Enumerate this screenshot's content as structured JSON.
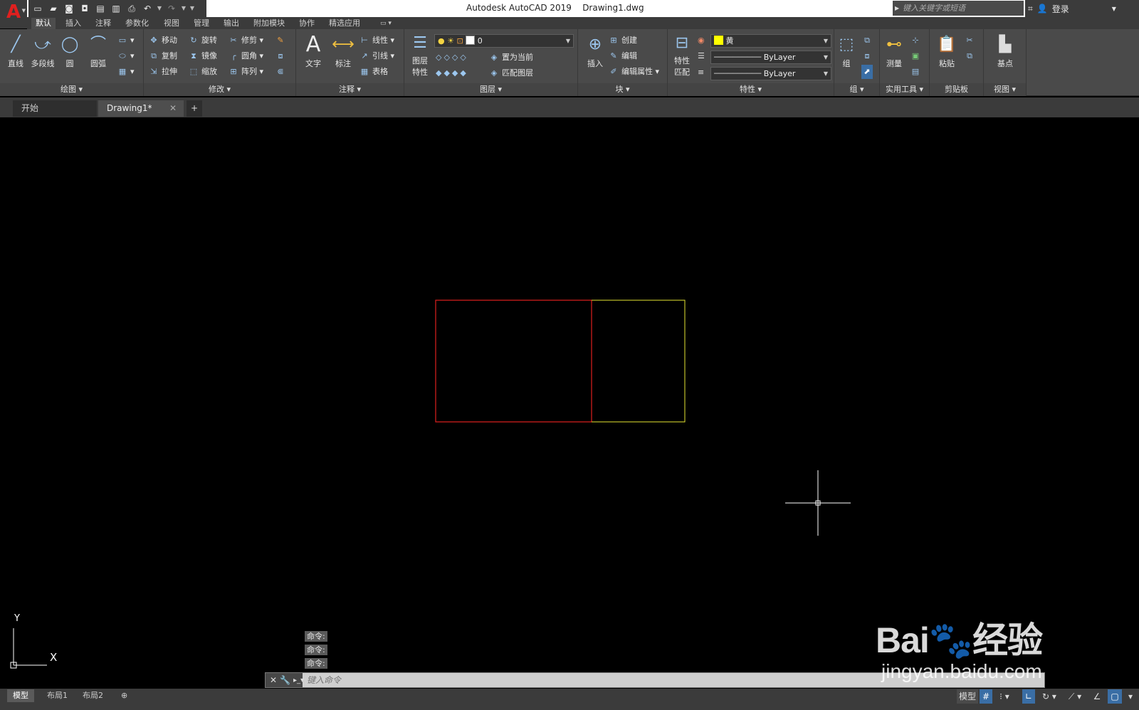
{
  "app": {
    "logo": "A",
    "title": "Autodesk AutoCAD 2019",
    "filename": "Drawing1.dwg"
  },
  "search": {
    "placeholder": "键入关键字或短语"
  },
  "user": {
    "login": "登录"
  },
  "ribbon_tabs": [
    "默认",
    "插入",
    "注释",
    "参数化",
    "视图",
    "管理",
    "输出",
    "附加模块",
    "协作",
    "精选应用"
  ],
  "panels": {
    "draw": {
      "title": "绘图",
      "line": "直线",
      "polyline": "多段线",
      "circle": "圆",
      "arc": "圆弧"
    },
    "modify": {
      "title": "修改",
      "move": "移动",
      "rotate": "旋转",
      "trim": "修剪",
      "copy": "复制",
      "mirror": "镜像",
      "fillet": "圆角",
      "stretch": "拉伸",
      "scale": "缩放",
      "array": "阵列"
    },
    "annotation": {
      "title": "注释",
      "text": "文字",
      "dimension": "标注",
      "linear": "线性",
      "leader": "引线",
      "table": "表格"
    },
    "layers": {
      "title": "图层",
      "properties_line1": "图层",
      "properties_line2": "特性",
      "current_layer": "0",
      "make_current": "置为当前",
      "match_layer": "匹配图层"
    },
    "block": {
      "title": "块",
      "insert": "插入",
      "create": "创建",
      "edit": "编辑",
      "edit_attributes": "编辑属性"
    },
    "properties": {
      "title": "特性",
      "match_line1": "特性",
      "match_line2": "匹配",
      "color": "黄",
      "linetype": "ByLayer",
      "lineweight": "ByLayer"
    },
    "groups": {
      "title": "组",
      "group": "组"
    },
    "utilities": {
      "title": "实用工具",
      "measure": "测量"
    },
    "clipboard": {
      "title": "剪贴板",
      "paste": "粘贴"
    },
    "view": {
      "title": "视图",
      "basepoint": "基点"
    }
  },
  "doc_tabs": {
    "start": "开始",
    "current": "Drawing1*"
  },
  "command": {
    "history": [
      "命令:",
      "命令:",
      "命令:"
    ],
    "placeholder": "键入命令"
  },
  "ucs": {
    "x": "X",
    "y": "Y"
  },
  "layout_tabs": [
    "模型",
    "布局1",
    "布局2"
  ],
  "status": {
    "model": "模型"
  },
  "watermark": {
    "brand": "Bai",
    "sub": "经验",
    "url": "jingyan.baidu.com"
  },
  "colors": {
    "red_rect": "#e0201f",
    "yellow_rect": "#e6e632",
    "yellow_swatch": "#ffff00"
  }
}
